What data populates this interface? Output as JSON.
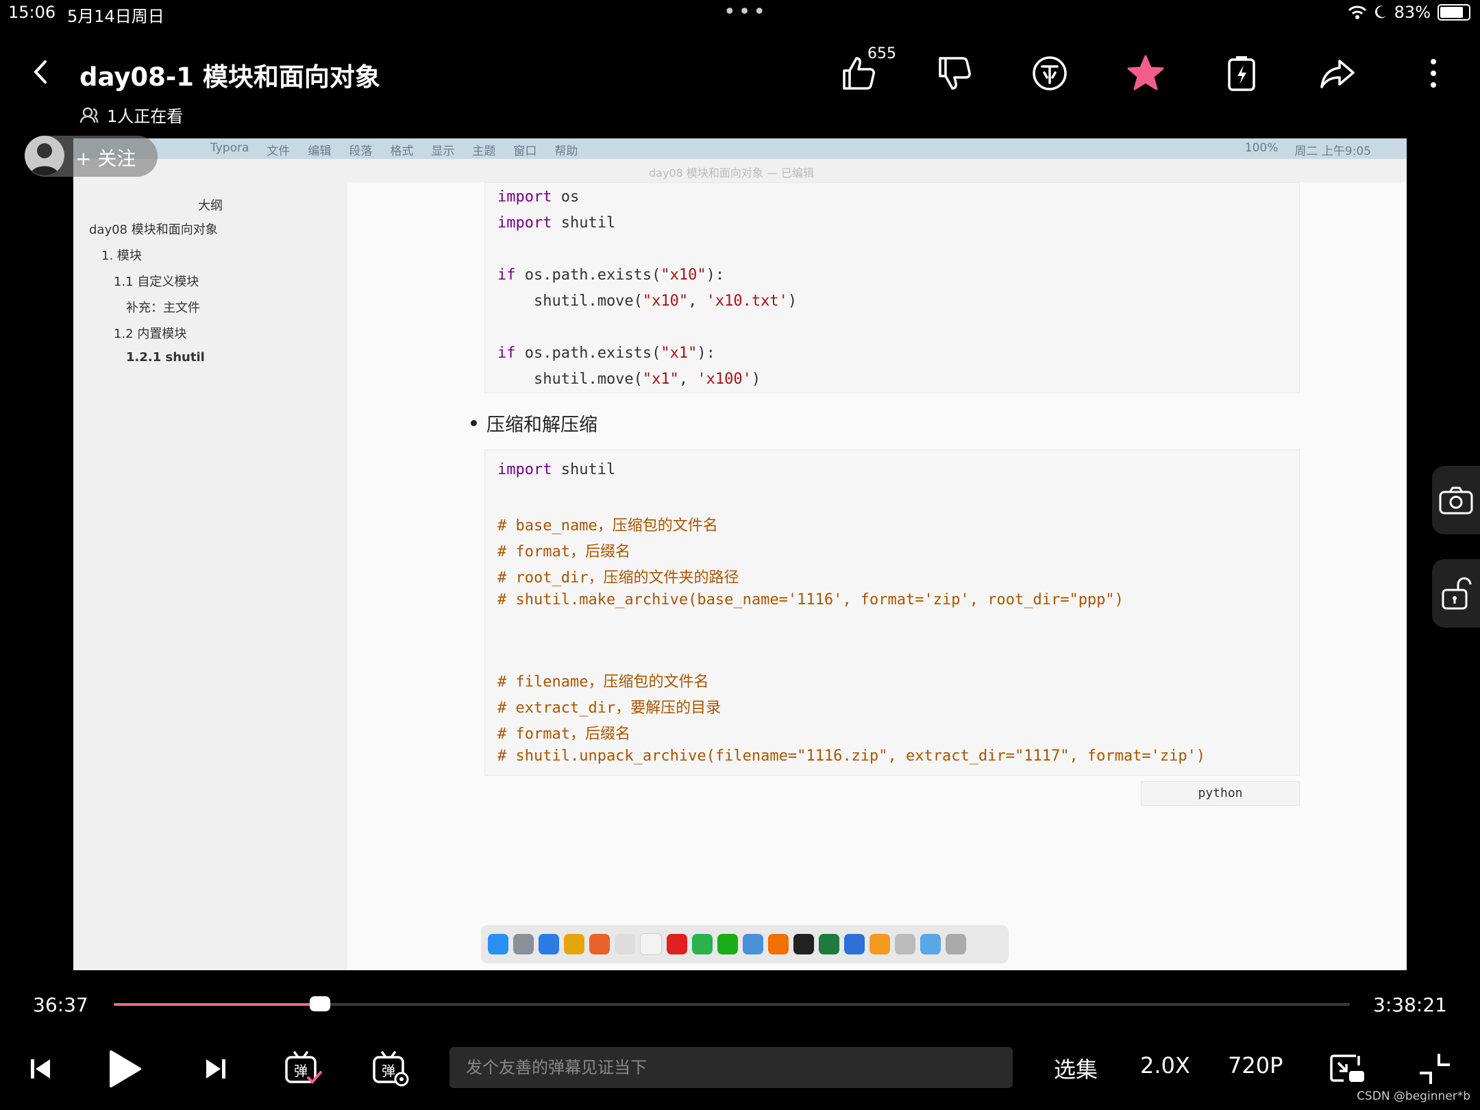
{
  "status": {
    "time": "15:06",
    "date": "5月14日周日",
    "battery": "83%"
  },
  "header": {
    "title": "day08-1 模块和面向对象",
    "viewers": "1人正在看",
    "like_count": "655"
  },
  "follow": {
    "label": "+ 关注"
  },
  "video": {
    "menubar": {
      "items": [
        "Typora",
        "文件",
        "编辑",
        "段落",
        "格式",
        "显示",
        "主题",
        "窗口",
        "帮助"
      ],
      "right": [
        "100%",
        "周二 上午9:05"
      ]
    },
    "window_title": "day08 模块和面向对象 — 已编辑",
    "outline": {
      "heading": "大纲",
      "items": [
        "day08 模块和面向对象",
        "1. 模块",
        "1.1 自定义模块",
        "补充：主文件",
        "1.2 内置模块",
        "1.2.1 shutil"
      ]
    },
    "bullet": "压缩和解压缩",
    "code_lang": "python"
  },
  "player": {
    "current_time": "36:37",
    "total_time": "3:38:21",
    "progress": 0.167,
    "danmu_placeholder": "发个友善的弹幕见证当下",
    "episodes": "选集",
    "speed": "2.0X",
    "quality": "720P"
  },
  "watermark": "CSDN @beginner*b"
}
